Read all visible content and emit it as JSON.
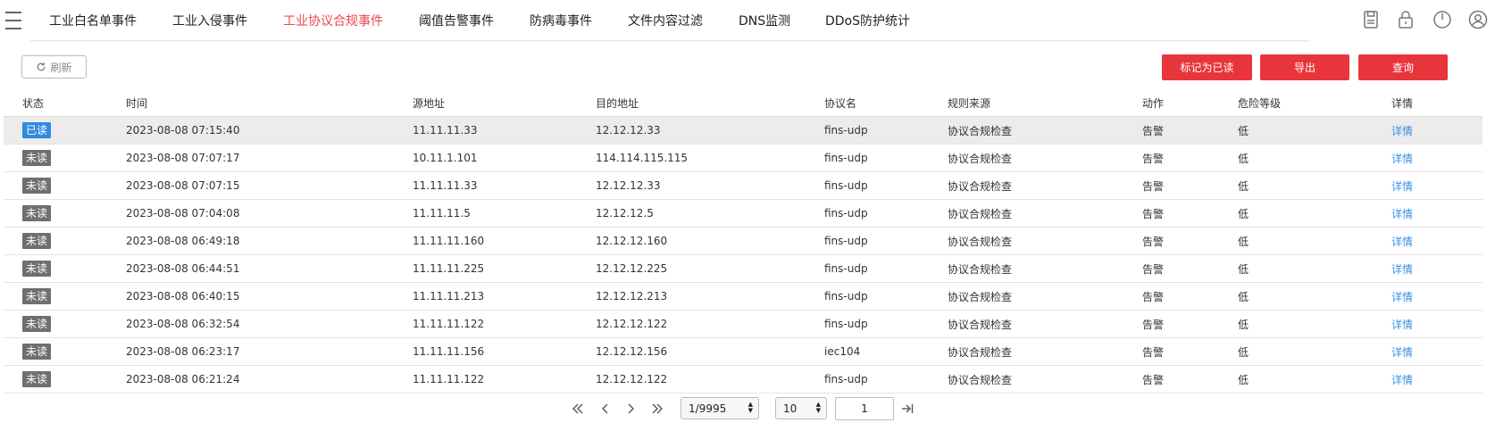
{
  "nav": {
    "tabs": [
      {
        "label": "工业白名单事件",
        "active": false
      },
      {
        "label": "工业入侵事件",
        "active": false
      },
      {
        "label": "工业协议合规事件",
        "active": true
      },
      {
        "label": "阈值告警事件",
        "active": false
      },
      {
        "label": "防病毒事件",
        "active": false
      },
      {
        "label": "文件内容过滤",
        "active": false
      },
      {
        "label": "DNS监测",
        "active": false
      },
      {
        "label": "DDoS防护统计",
        "active": false
      }
    ],
    "icons": [
      "save-icon",
      "lock-icon",
      "power-icon",
      "user-icon"
    ],
    "accent_color": "#f0454a"
  },
  "toolbar": {
    "refresh_label": "刷新",
    "mark_read_label": "标记为已读",
    "export_label": "导出",
    "query_label": "查询",
    "button_color": "#e8353b"
  },
  "table": {
    "headers": [
      "状态",
      "时间",
      "源地址",
      "目的地址",
      "协议名",
      "规则来源",
      "动作",
      "危险等级",
      "详情"
    ],
    "rows": [
      {
        "status": "已读",
        "read": true,
        "time": "2023-08-08 07:15:40",
        "src": "11.11.11.33",
        "dst": "12.12.12.33",
        "protocol": "fins-udp",
        "rule": "协议合规检查",
        "action": "告警",
        "level": "低",
        "detail": "详情"
      },
      {
        "status": "未读",
        "read": false,
        "time": "2023-08-08 07:07:17",
        "src": "10.11.1.101",
        "dst": "114.114.115.115",
        "protocol": "fins-udp",
        "rule": "协议合规检查",
        "action": "告警",
        "level": "低",
        "detail": "详情"
      },
      {
        "status": "未读",
        "read": false,
        "time": "2023-08-08 07:07:15",
        "src": "11.11.11.33",
        "dst": "12.12.12.33",
        "protocol": "fins-udp",
        "rule": "协议合规检查",
        "action": "告警",
        "level": "低",
        "detail": "详情"
      },
      {
        "status": "未读",
        "read": false,
        "time": "2023-08-08 07:04:08",
        "src": "11.11.11.5",
        "dst": "12.12.12.5",
        "protocol": "fins-udp",
        "rule": "协议合规检查",
        "action": "告警",
        "level": "低",
        "detail": "详情"
      },
      {
        "status": "未读",
        "read": false,
        "time": "2023-08-08 06:49:18",
        "src": "11.11.11.160",
        "dst": "12.12.12.160",
        "protocol": "fins-udp",
        "rule": "协议合规检查",
        "action": "告警",
        "level": "低",
        "detail": "详情"
      },
      {
        "status": "未读",
        "read": false,
        "time": "2023-08-08 06:44:51",
        "src": "11.11.11.225",
        "dst": "12.12.12.225",
        "protocol": "fins-udp",
        "rule": "协议合规检查",
        "action": "告警",
        "level": "低",
        "detail": "详情"
      },
      {
        "status": "未读",
        "read": false,
        "time": "2023-08-08 06:40:15",
        "src": "11.11.11.213",
        "dst": "12.12.12.213",
        "protocol": "fins-udp",
        "rule": "协议合规检查",
        "action": "告警",
        "level": "低",
        "detail": "详情"
      },
      {
        "status": "未读",
        "read": false,
        "time": "2023-08-08 06:32:54",
        "src": "11.11.11.122",
        "dst": "12.12.12.122",
        "protocol": "fins-udp",
        "rule": "协议合规检查",
        "action": "告警",
        "level": "低",
        "detail": "详情"
      },
      {
        "status": "未读",
        "read": false,
        "time": "2023-08-08 06:23:17",
        "src": "11.11.11.156",
        "dst": "12.12.12.156",
        "protocol": "iec104",
        "rule": "协议合规检查",
        "action": "告警",
        "level": "低",
        "detail": "详情"
      },
      {
        "status": "未读",
        "read": false,
        "time": "2023-08-08 06:21:24",
        "src": "11.11.11.122",
        "dst": "12.12.12.122",
        "protocol": "fins-udp",
        "rule": "协议合规检查",
        "action": "告警",
        "level": "低",
        "detail": "详情"
      }
    ]
  },
  "pager": {
    "page_select": "1/9995",
    "page_size": "10",
    "page_input": "1"
  }
}
